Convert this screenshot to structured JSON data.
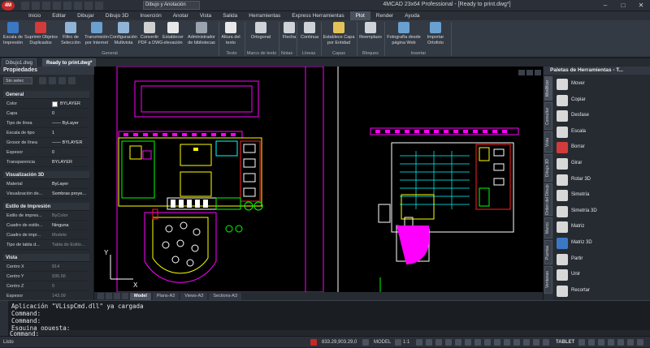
{
  "titlebar": {
    "title": "4MCAD 23x64 Professional - [Ready to print.dwg*]",
    "workspace": "Dibujo y Anotación",
    "logo_icon": "4mcad-logo-icon",
    "minimize": "–",
    "maximize": "□",
    "close": "✕"
  },
  "menu": [
    "Inicio",
    "Editar",
    "Dibujar",
    "Dibujo 3D",
    "Inserción",
    "Anotar",
    "Vista",
    "Salida",
    "Herramientas",
    "Express Herramientas",
    "Plot",
    "Render",
    "Ayuda"
  ],
  "menu_active_index": 10,
  "ribbon": {
    "buttons": [
      {
        "label": "Escala de\nImpresión",
        "icon": "print-scale-icon",
        "color": "#3b78c4"
      },
      {
        "label": "Suprimir Objetos\nDuplicados",
        "icon": "delete-duplicates-icon",
        "color": "#d23b3b"
      },
      {
        "label": "Filtro de\nSelección",
        "icon": "selection-filter-icon",
        "color": "#8fb4d8"
      },
      {
        "label": "Transmisión\npor Internet",
        "icon": "etransmit-icon",
        "color": "#6aa0d0"
      },
      {
        "label": "Configuración\nMultivista",
        "icon": "multiview-config-icon",
        "color": "#8fb4d8"
      },
      {
        "label": "Convertir\nPDF a DWG",
        "icon": "pdf-to-dwg-icon",
        "color": "#d0d0d0"
      },
      {
        "label": "Establecer\nelevación",
        "icon": "set-elevation-icon",
        "color": "#e8e8e8"
      },
      {
        "label": "Administrador\nde bibliotecas",
        "icon": "library-manager-icon",
        "color": "#9aa4b0"
      },
      {
        "label": "Altura del\ntexto",
        "icon": "text-height-icon",
        "color": "#e8e8e8"
      },
      {
        "label": "Ortogonal",
        "icon": "orthogonal-icon",
        "color": "#cfd3d8"
      },
      {
        "label": "Flecha",
        "icon": "arrow-icon",
        "color": "#cfd3d8"
      },
      {
        "label": "Continua",
        "icon": "linetype-continuous-icon",
        "color": "#cfd3d8"
      },
      {
        "label": "Establece Capa\npor Entidad",
        "icon": "layer-by-entity-icon",
        "color": "#e3c25a"
      },
      {
        "label": "Reemplazo",
        "icon": "block-replace-icon",
        "color": "#cfd3d8"
      },
      {
        "label": "Fotografía desde\npágina Web",
        "icon": "web-photo-icon",
        "color": "#6aa0d0"
      },
      {
        "label": "Importar\nOrtofoto",
        "icon": "import-orthophoto-icon",
        "color": "#6aa0d0"
      }
    ],
    "groups": [
      "General",
      "Texto",
      "Marco de texto",
      "Notas",
      "Líneas",
      "Capas",
      "Bloques",
      "Insertar"
    ]
  },
  "doc_tabs": [
    "Dibujo1.dwg",
    "Ready to print.dwg*"
  ],
  "properties": {
    "title": "Propiedades",
    "selection": "Sin selec",
    "sections": {
      "general": {
        "title": "General",
        "rows": [
          {
            "label": "Color",
            "value": "BYLAYER"
          },
          {
            "label": "Capa",
            "value": "0"
          },
          {
            "label": "Tipo de línea",
            "value": "—— ByLayer"
          },
          {
            "label": "Escala de tipo",
            "value": "1"
          },
          {
            "label": "Grosor de línea",
            "value": "—— BYLAYER"
          },
          {
            "label": "Espesor",
            "value": "0"
          },
          {
            "label": "Transparencia",
            "value": "BYLAYER"
          }
        ]
      },
      "vis3d": {
        "title": "Visualización 3D",
        "rows": [
          {
            "label": "Material",
            "value": "ByLayer"
          },
          {
            "label": "Visualización de...",
            "value": "Sombras proye..."
          }
        ]
      },
      "plot": {
        "title": "Estilo de Impresión",
        "rows": [
          {
            "label": "Estilo de impres...",
            "value": "ByColor"
          },
          {
            "label": "Cuadro de estilo...",
            "value": "Ninguna"
          },
          {
            "label": "Cuadro de impr...",
            "value": "Modelo"
          },
          {
            "label": "Tipo de tabla d...",
            "value": "Tabla de Estilo..."
          }
        ]
      },
      "view": {
        "title": "Vista",
        "rows": [
          {
            "label": "Centro X",
            "value": "814"
          },
          {
            "label": "Centro Y",
            "value": "935.56"
          },
          {
            "label": "Centro Z",
            "value": "0"
          },
          {
            "label": "Espesor",
            "value": "143.09"
          }
        ]
      }
    }
  },
  "layout_tabs": [
    "Model",
    "Plans-A3",
    "Views-A3",
    "Sections-A3"
  ],
  "palette": {
    "title": "Paletas de Herramientas - T...",
    "vtabs": [
      "Modificar",
      "Consultar",
      "Vista",
      "Dibujo 3D",
      "Orden del Dibujo",
      "Marco",
      "Puertas",
      "Ventanas"
    ],
    "tools": [
      {
        "label": "Mover",
        "icon": "move-icon",
        "color": "#d8d8d8"
      },
      {
        "label": "Copiar",
        "icon": "copy-icon",
        "color": "#d8d8d8"
      },
      {
        "label": "Desfase",
        "icon": "offset-icon",
        "color": "#d8d8d8"
      },
      {
        "label": "Escala",
        "icon": "scale-icon",
        "color": "#d8d8d8"
      },
      {
        "label": "Borrar",
        "icon": "erase-icon",
        "color": "#d23b3b"
      },
      {
        "label": "Girar",
        "icon": "rotate-icon",
        "color": "#d8d8d8"
      },
      {
        "label": "Rotar 3D",
        "icon": "rotate-3d-icon",
        "color": "#d8d8d8"
      },
      {
        "label": "Simetría",
        "icon": "mirror-icon",
        "color": "#d8d8d8"
      },
      {
        "label": "Simetría 3D",
        "icon": "mirror-3d-icon",
        "color": "#d8d8d8"
      },
      {
        "label": "Matriz",
        "icon": "array-icon",
        "color": "#d8d8d8"
      },
      {
        "label": "Matriz 3D",
        "icon": "array-3d-icon",
        "color": "#3b78c4"
      },
      {
        "label": "Partir",
        "icon": "break-icon",
        "color": "#d8d8d8"
      },
      {
        "label": "Unir",
        "icon": "join-icon",
        "color": "#d8d8d8"
      },
      {
        "label": "Recortar",
        "icon": "trim-icon",
        "color": "#d8d8d8"
      }
    ]
  },
  "command": {
    "lines": [
      "Aplicación \"VLispCmd.dll\" ya cargada",
      "Command:",
      "Command:",
      "Esquina opuesta:"
    ],
    "prompt": "Command:"
  },
  "status": {
    "ready": "Listo",
    "coords": "833.29,903.29,0",
    "model": "MODEL",
    "scale": "1:1",
    "tablet": "TABLET"
  },
  "colors": {
    "accent": "#4a525e",
    "magenta": "#ff00ff",
    "yellow": "#ffff00",
    "cyan": "#00ffff",
    "green": "#00ff00",
    "red": "#ff2020"
  }
}
